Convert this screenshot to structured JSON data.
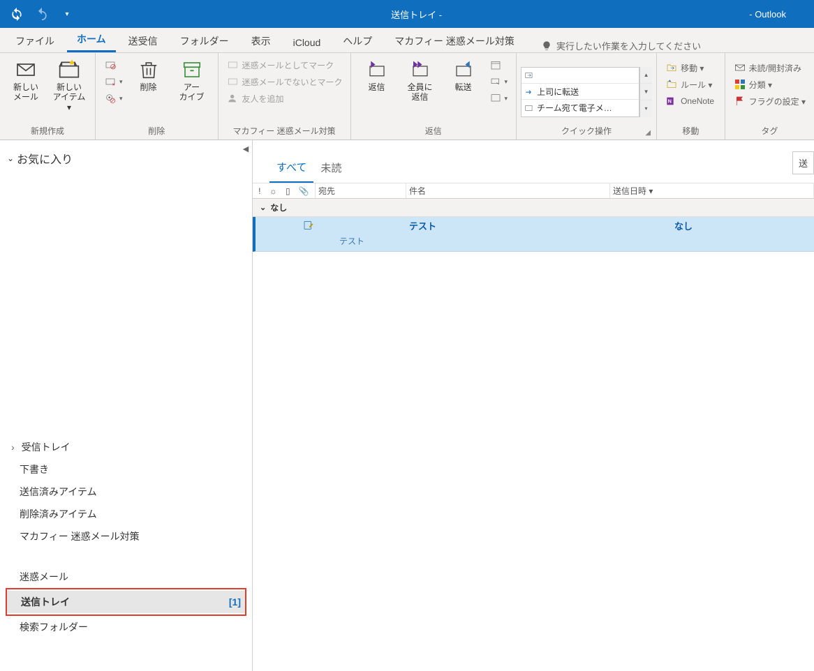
{
  "titlebar": {
    "title": "送信トレイ -",
    "right": "-  Outlook"
  },
  "tabs": {
    "items": [
      "ファイル",
      "ホーム",
      "送受信",
      "フォルダー",
      "表示",
      "iCloud",
      "ヘルプ",
      "マカフィー 迷惑メール対策"
    ],
    "active_index": 1,
    "tellme": "実行したい作業を入力してください"
  },
  "ribbon": {
    "group_new": {
      "label": "新規作成",
      "btn_newmail": "新しい\nメール",
      "btn_newitems": "新しい\nアイテム ▾"
    },
    "group_delete": {
      "label": "削除",
      "btn_delete": "削除",
      "btn_archive": "アー\nカイブ"
    },
    "group_mcafee": {
      "label": "マカフィー 迷惑メール対策",
      "mark_junk": "迷惑メールとしてマーク",
      "mark_not_junk": "迷惑メールでないとマーク",
      "add_friend": "友人を追加"
    },
    "group_reply": {
      "label": "返信",
      "btn_reply": "返信",
      "btn_replyall": "全員に\n返信",
      "btn_forward": "転送"
    },
    "group_quick": {
      "label": "クイック操作",
      "q1": "",
      "q2": "上司に転送",
      "q3": "チーム宛て電子メ…"
    },
    "group_move": {
      "label": "移動",
      "move": "移動 ▾",
      "rules": "ルール ▾",
      "onenote": "OneNote"
    },
    "group_tags": {
      "label": "タグ",
      "unread": "未読/開封済み",
      "categorize": "分類 ▾",
      "flag": "フラグの設定 ▾"
    }
  },
  "nav": {
    "favorites_header": "お気に入り",
    "inbox": "受信トレイ",
    "drafts": "下書き",
    "sent": "送信済みアイテム",
    "deleted": "削除済みアイテム",
    "mcafee": "マカフィー 迷惑メール対策",
    "junk": "迷惑メール",
    "outbox": "送信トレイ",
    "outbox_count": "[1]",
    "search_folders": "検索フォルダー"
  },
  "filters": {
    "all": "すべて",
    "unread": "未読"
  },
  "columns": {
    "to": "宛先",
    "subject": "件名",
    "date": "送信日時 ▾"
  },
  "group_header": "なし",
  "message": {
    "subject": "テスト",
    "preview": "テスト",
    "date": "なし"
  }
}
